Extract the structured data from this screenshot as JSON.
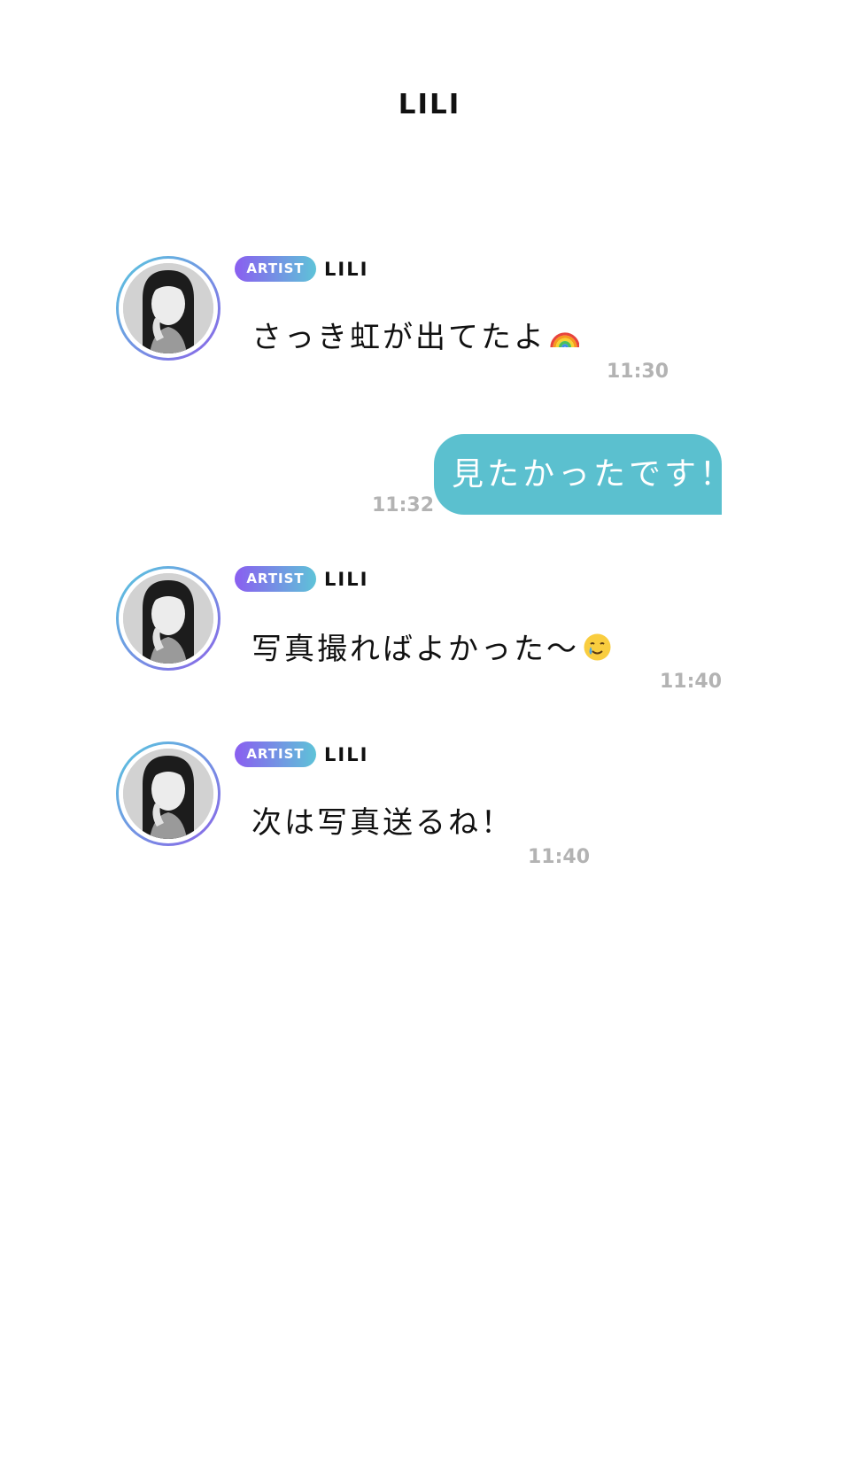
{
  "header": {
    "title": "LILI"
  },
  "colors": {
    "outgoing_bubble": "#5bc0cf",
    "badge_gradient_start": "#8a5ef0",
    "badge_gradient_end": "#5ec3d8",
    "timestamp": "#b3b3b3"
  },
  "messages": [
    {
      "direction": "incoming",
      "badge": "ARTIST",
      "sender": "LILI",
      "text": "さっき虹が出てたよ",
      "emoji": "rainbow-emoji",
      "time": "11:30"
    },
    {
      "direction": "outgoing",
      "text": "見たかったです！",
      "time": "11:32"
    },
    {
      "direction": "incoming",
      "badge": "ARTIST",
      "sender": "LILI",
      "text": "写真撮ればよかった〜",
      "emoji": "smiling-face-with-tear-emoji",
      "time": "11:40"
    },
    {
      "direction": "incoming",
      "badge": "ARTIST",
      "sender": "LILI",
      "text": "次は写真送るね！",
      "time": "11:40"
    }
  ]
}
